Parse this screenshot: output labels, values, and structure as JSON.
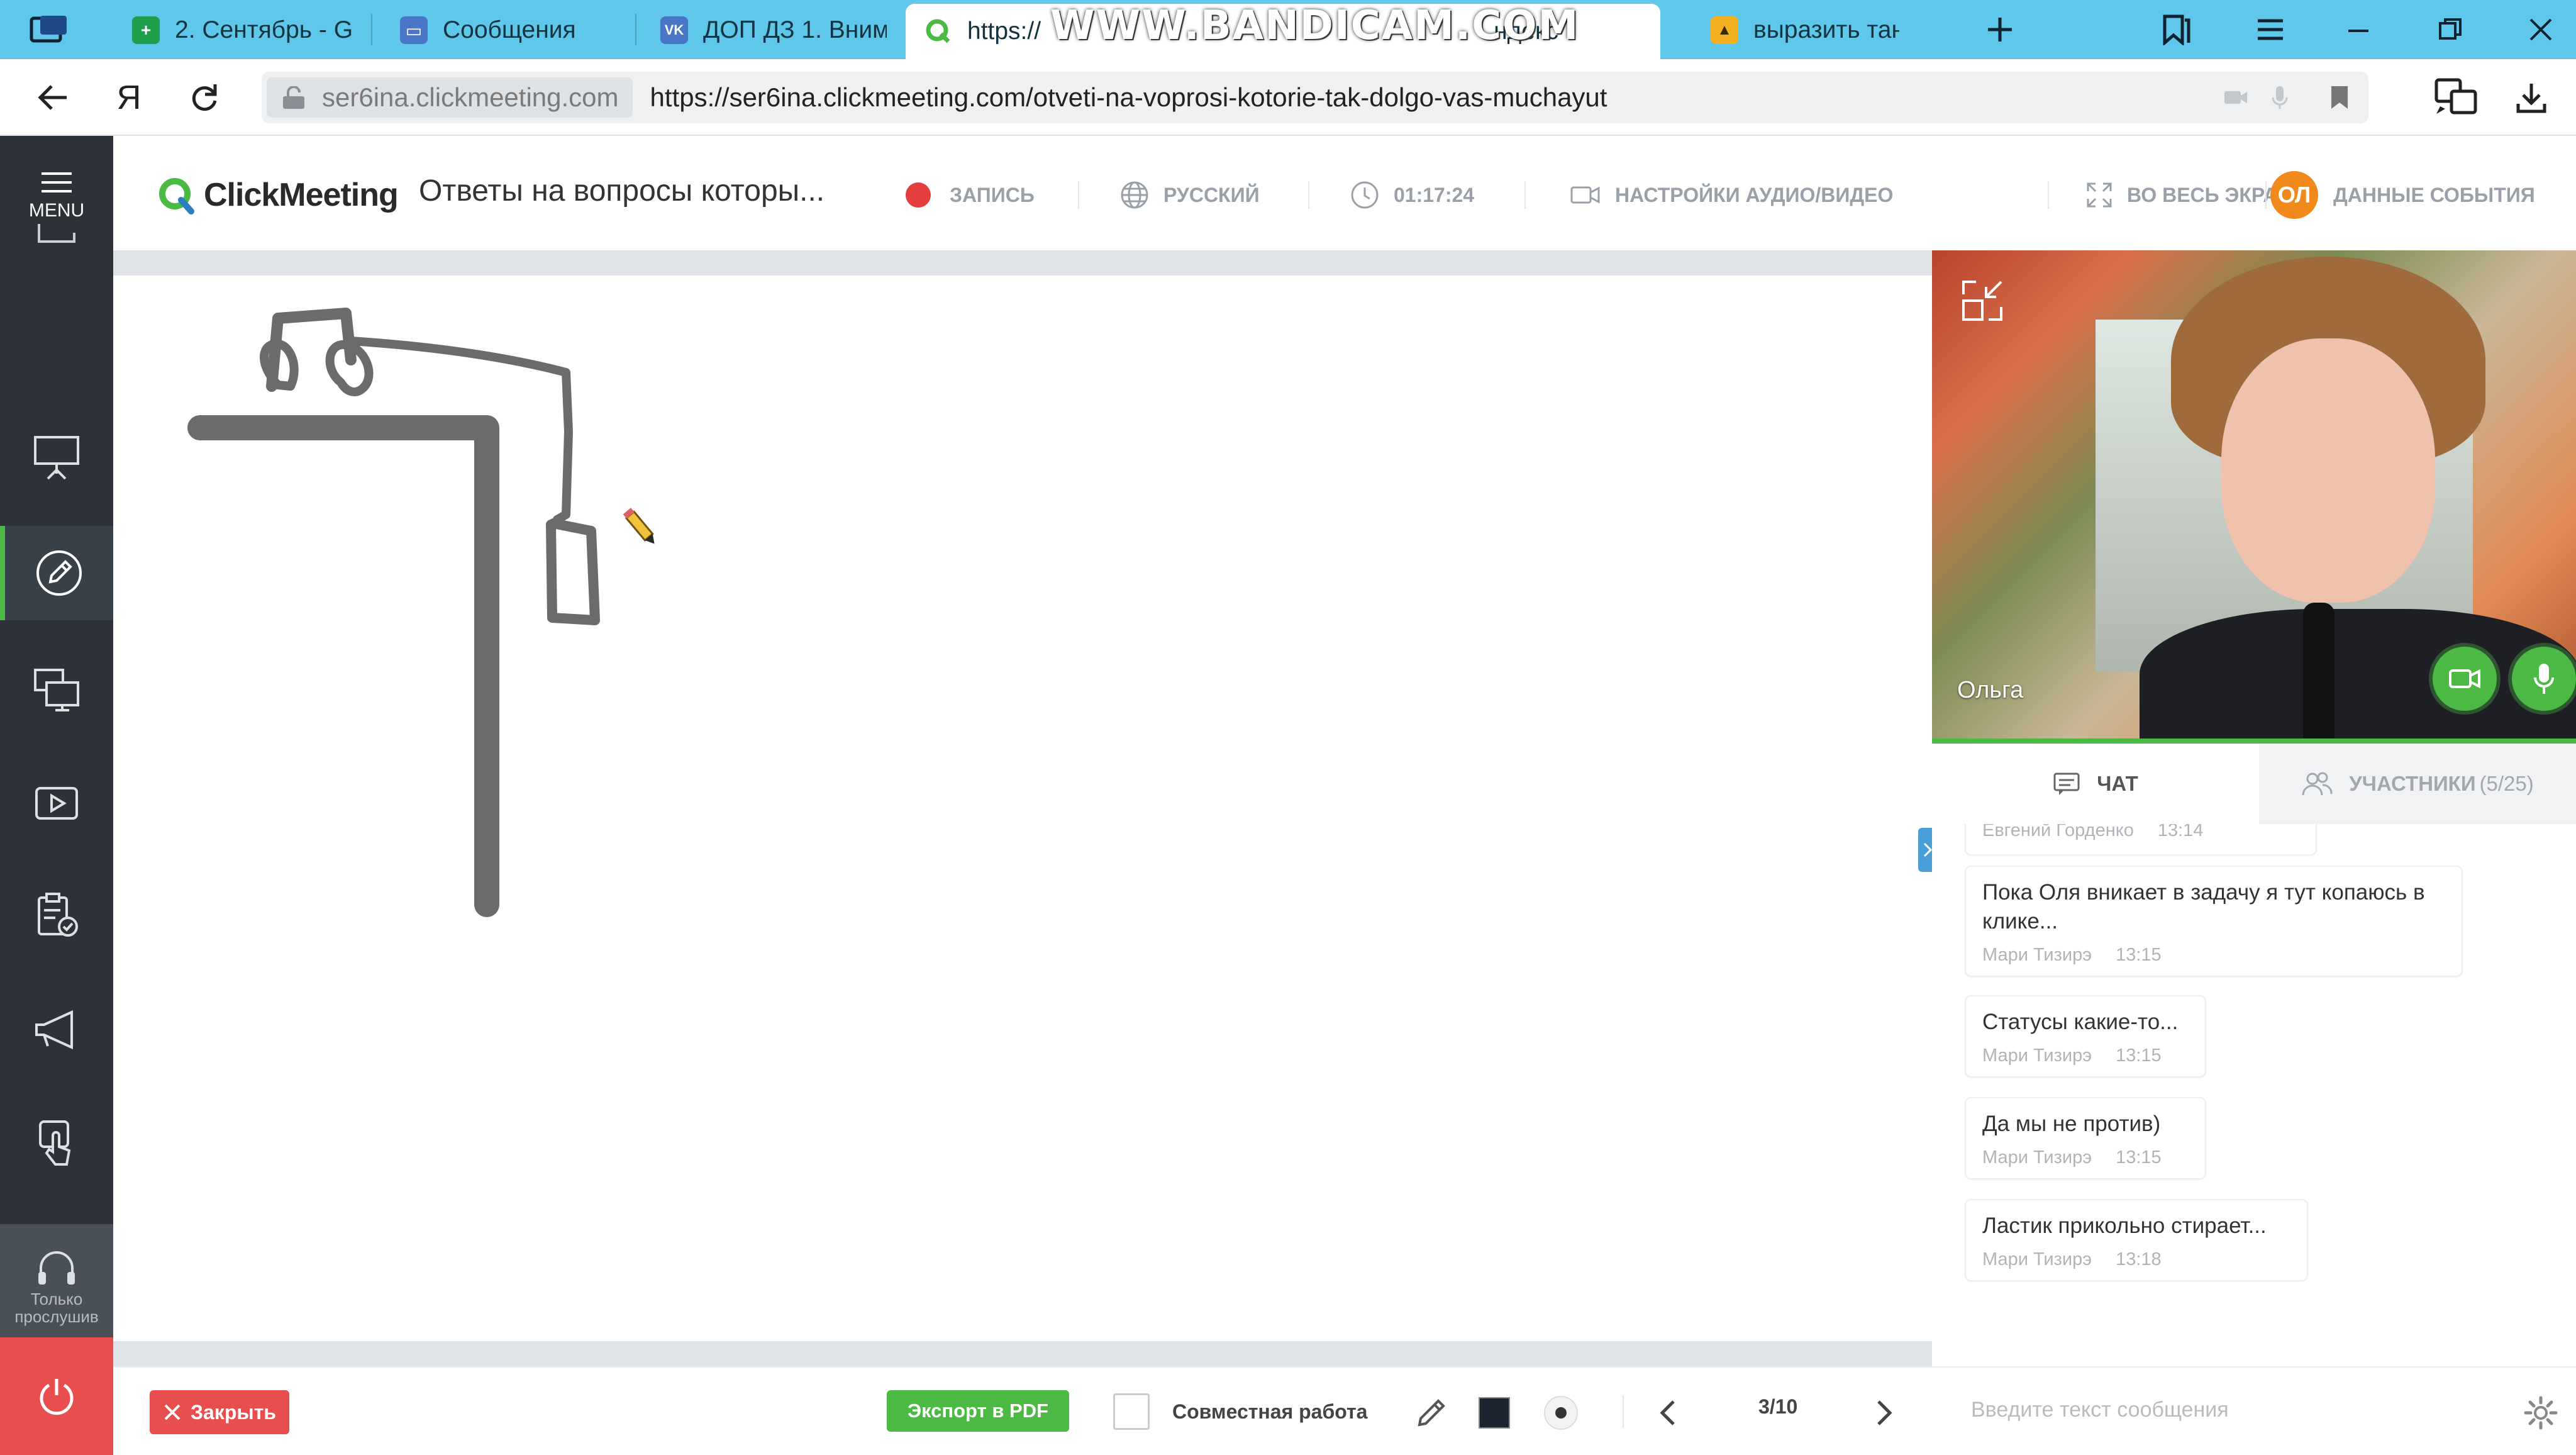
{
  "browser": {
    "tabs": [
      {
        "label": "2. Сентябрь - G",
        "color": "#1e9e4a",
        "glyph": "+"
      },
      {
        "label": "Сообщения",
        "color": "#4a76c8",
        "glyph": "▭"
      },
      {
        "label": "ДОП ДЗ 1. Вним",
        "color": "#4a76c8",
        "glyph": "VK"
      },
      {
        "label": "https://",
        "color": "#4cb944",
        "glyph": "Q"
      },
      {
        "label": "ндекс",
        "color": "#ffffff",
        "glyph": ""
      },
      {
        "label": "выразить танге",
        "color": "#f2b01e",
        "glyph": "▲"
      }
    ],
    "watermark": "WWW.BANDICAM.COM",
    "address": {
      "host": "ser6ina.clickmeeting.com",
      "url": "https://ser6ina.clickmeeting.com/otveti-na-voprosi-kotorie-tak-dolgo-vas-muchayut"
    }
  },
  "sidebar": {
    "menu_label": "MENU",
    "listen_only": [
      "Только",
      "прослушив"
    ]
  },
  "header": {
    "logo": "ClickMeeting",
    "event_title": "Ответы на вопросы которы...",
    "record": "ЗАПИСЬ",
    "language": "РУССКИЙ",
    "timer": "01:17:24",
    "av_settings": "НАСТРОЙКИ АУДИО/ВИДЕО",
    "fullscreen": "ВО ВЕСЬ ЭКРАН",
    "avatar_initials": "ОЛ",
    "event_data": "ДАННЫЕ СОБЫТИЯ"
  },
  "video": {
    "presenter_name": "Ольга"
  },
  "panel_tabs": {
    "chat": "ЧАТ",
    "participants": "УЧАСТНИКИ",
    "participants_count": "(5/25)"
  },
  "chat": {
    "cut_meta": {
      "author": "Евгений Горденко",
      "time": "13:14"
    },
    "messages": [
      {
        "text": "Пока Оля вникает в задачу я тут копаюсь в клике...",
        "author": "Мари Тизирэ",
        "time": "13:15"
      },
      {
        "text": "Статусы какие-то...",
        "author": "Мари Тизирэ",
        "time": "13:15"
      },
      {
        "text": "Да мы не против)",
        "author": "Мари Тизирэ",
        "time": "13:15"
      },
      {
        "text": "Ластик прикольно стирает...",
        "author": "Мари Тизирэ",
        "time": "13:18"
      }
    ],
    "input_placeholder": "Введите текст сообщения"
  },
  "bottom": {
    "close": "Закрыть",
    "export_pdf": "Экспорт в PDF",
    "collaboration": "Совместная работа",
    "page": "3/10"
  },
  "colors": {
    "accent_green": "#4cb944",
    "danger_red": "#e84e4e",
    "sidebar_bg": "#2d3238",
    "browser_bar": "#5fc7e9",
    "pen_color": "#1c2330"
  }
}
